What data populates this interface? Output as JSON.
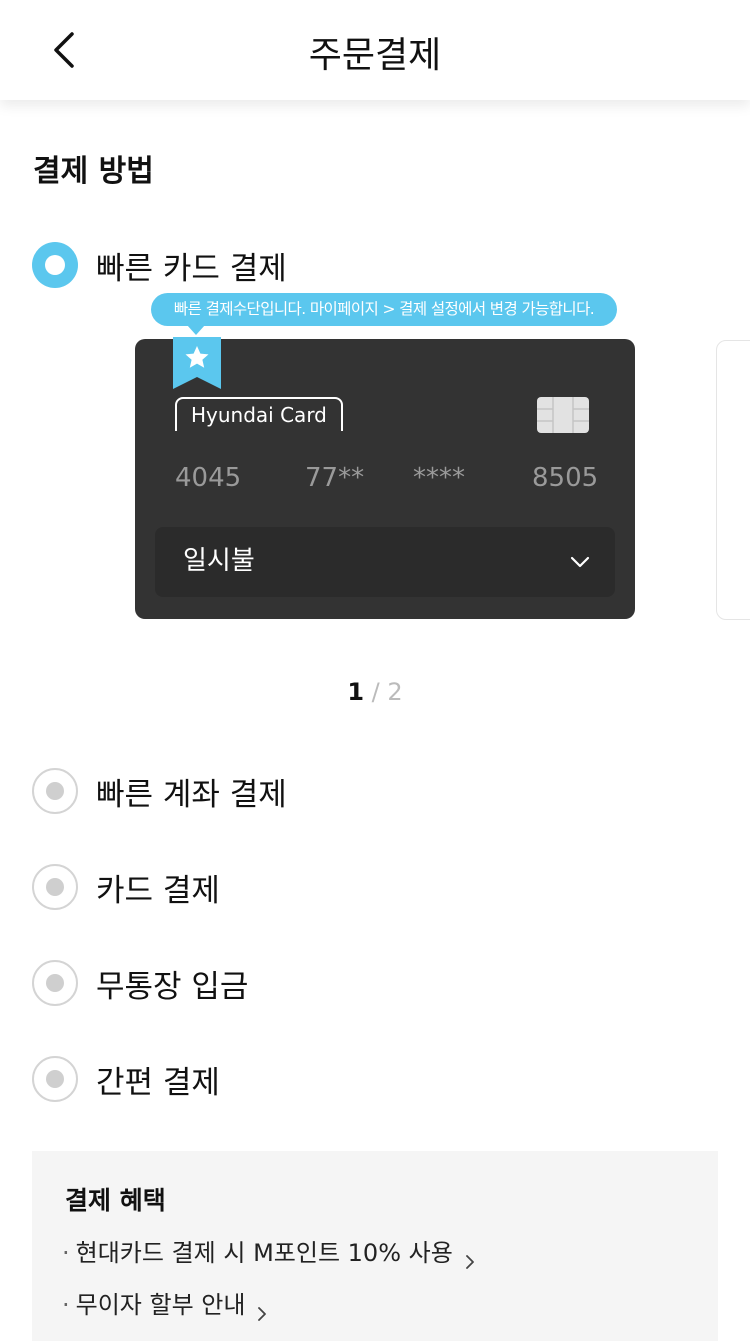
{
  "header": {
    "title": "주문결제"
  },
  "section_title": "결제 방법",
  "options": [
    {
      "label": "빠른 카드 결제",
      "selected": true
    },
    {
      "label": "빠른 계좌 결제",
      "selected": false
    },
    {
      "label": "카드 결제",
      "selected": false
    },
    {
      "label": "무통장 입금",
      "selected": false
    },
    {
      "label": "간편 결제",
      "selected": false
    }
  ],
  "tooltip": "빠른 결제수단입니다. 마이페이지 > 결제 설정에서 변경 가능합니다.",
  "card": {
    "brand": "Hyundai Card",
    "number": [
      "4045",
      "77**",
      "****",
      "8505"
    ],
    "installment": "일시불",
    "background_color": "#333333"
  },
  "pager": {
    "current": "1",
    "sep": "/",
    "total": "2"
  },
  "benefit": {
    "title": "결제 혜택",
    "items": [
      {
        "bullet": "·",
        "text": "현대카드 결제 시 M포인트 10% 사용"
      },
      {
        "bullet": "·",
        "text": "무이자 할부 안내"
      }
    ]
  },
  "colors": {
    "accent": "#5bc7ee"
  },
  "icons": [
    "back-arrow-icon",
    "star-bookmark-icon",
    "card-chip-icon",
    "chevron-down-icon",
    "chevron-right-icon"
  ]
}
